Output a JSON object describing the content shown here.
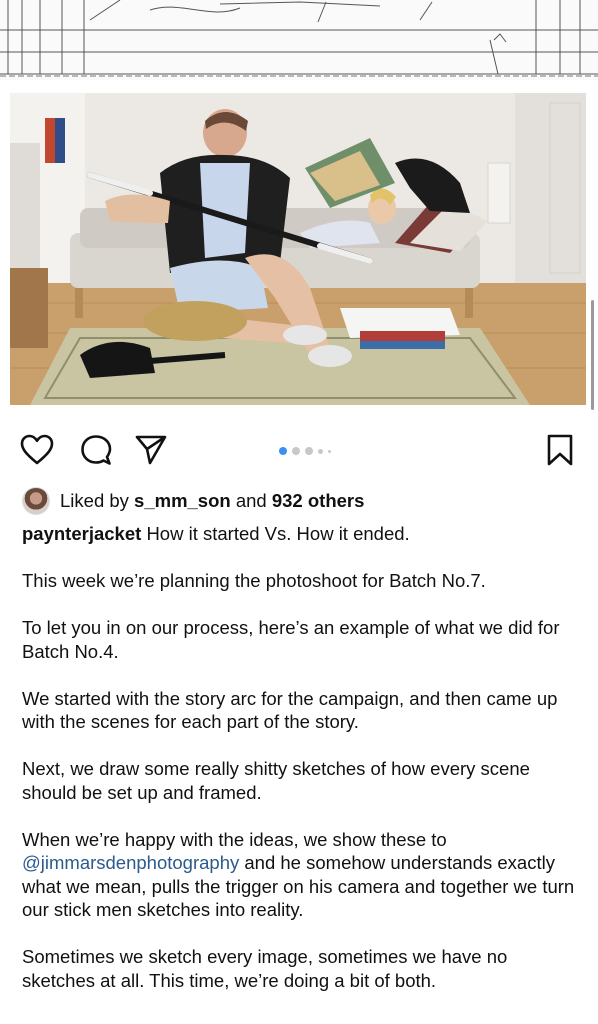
{
  "post": {
    "username": "paynterjacket",
    "caption_first_line": "How it started Vs. How it ended.",
    "paragraphs": [
      "This week we’re planning the photoshoot for Batch No.7.",
      "To let you in on our process, here’s an example of what we did for Batch No.4.",
      "We started with the story arc for the campaign, and then came up with the scenes for each part of the story.",
      "Next, we draw some really shitty sketches of how every scene should be set up and framed."
    ],
    "paragraph5_before": "When we’re happy with the ideas, we show these to",
    "mention": "@jimmarsdenphotography",
    "paragraph5_after": "and he somehow understands exactly what we mean, pulls the trigger on his camera and together we turn our stick men sketches into reality.",
    "paragraph6": "Sometimes we sketch every image, sometimes we have no sketches at all. This time, we’re doing a bit of both."
  },
  "likes": {
    "prefix": "Liked by",
    "user": "s_mm_son",
    "middle": "and",
    "others": "932 others"
  },
  "carousel": {
    "total": 5,
    "active_index": 0
  },
  "icons": [
    "heart-icon",
    "comment-icon",
    "share-icon",
    "bookmark-icon"
  ],
  "colors": {
    "accent": "#3b8ff0",
    "mention": "#2b5a8e"
  }
}
